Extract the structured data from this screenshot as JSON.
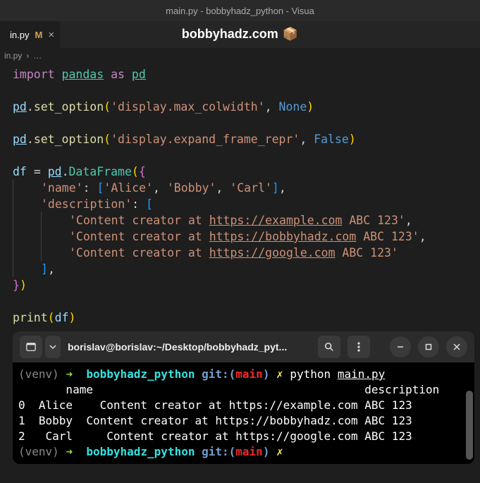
{
  "window": {
    "title": "main.py - bobbyhadz_python - Visua"
  },
  "tab": {
    "name": "in.py",
    "modified_marker": "M",
    "close": "×"
  },
  "watermark": {
    "text": "bobbyhadz.com",
    "icon": "📦"
  },
  "breadcrumb": {
    "file": "in.py",
    "sep": "›",
    "more": "…"
  },
  "code": {
    "import": "import",
    "pandas": "pandas",
    "as": "as",
    "pd": "pd",
    "set_option": "set_option",
    "opt1_key": "'display.max_colwidth'",
    "none": "None",
    "opt2_key": "'display.expand_frame_repr'",
    "false": "False",
    "df": "df",
    "DataFrame": "DataFrame",
    "name_key": "'name'",
    "names": [
      "'Alice'",
      "'Bobby'",
      "'Carl'"
    ],
    "desc_key": "'description'",
    "desc_prefix": "'Content creator at ",
    "urls": [
      "https://example.com",
      "https://bobbyhadz.com",
      "https://google.com"
    ],
    "desc_suffix": " ABC 123'",
    "print": "print"
  },
  "terminal": {
    "header_title": "borislav@borislav:~/Desktop/bobbyhadz_pyt...",
    "prompt": {
      "venv": "(venv)",
      "arrow": "➜",
      "dir": "bobbyhadz_python",
      "git": "git:(",
      "branch": "main",
      "git_close": ")",
      "dirty": "✗",
      "cmd": "python",
      "file": "main.py"
    },
    "output": {
      "header": "       name                                        description",
      "rows": [
        "0  Alice    Content creator at https://example.com ABC 123",
        "1  Bobby  Content creator at https://bobbyhadz.com ABC 123",
        "2   Carl     Content creator at https://google.com ABC 123"
      ]
    }
  }
}
